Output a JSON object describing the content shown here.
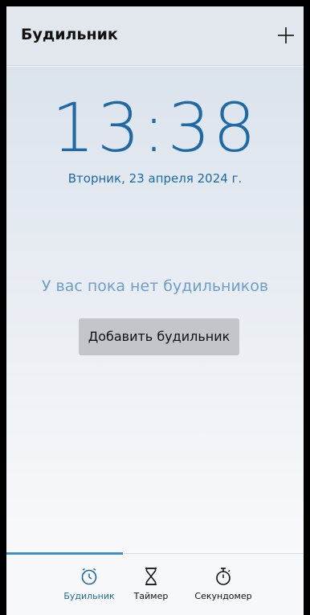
{
  "header": {
    "title": "Будильник"
  },
  "clock": {
    "time": "13:38",
    "date": "Вторник, 23 апреля 2024 г."
  },
  "empty_state": {
    "message": "У вас пока нет будильников",
    "add_button": "Добавить будильник"
  },
  "tabs": [
    {
      "label": "Будильник",
      "icon": "alarm-clock-icon",
      "active": true
    },
    {
      "label": "Таймер",
      "icon": "hourglass-icon",
      "active": false
    },
    {
      "label": "Секундомер",
      "icon": "stopwatch-icon",
      "active": false
    }
  ],
  "colors": {
    "accent": "#1f6aa5",
    "empty_text": "#6f9fc7",
    "tab_indicator": "#3f8fc6"
  }
}
